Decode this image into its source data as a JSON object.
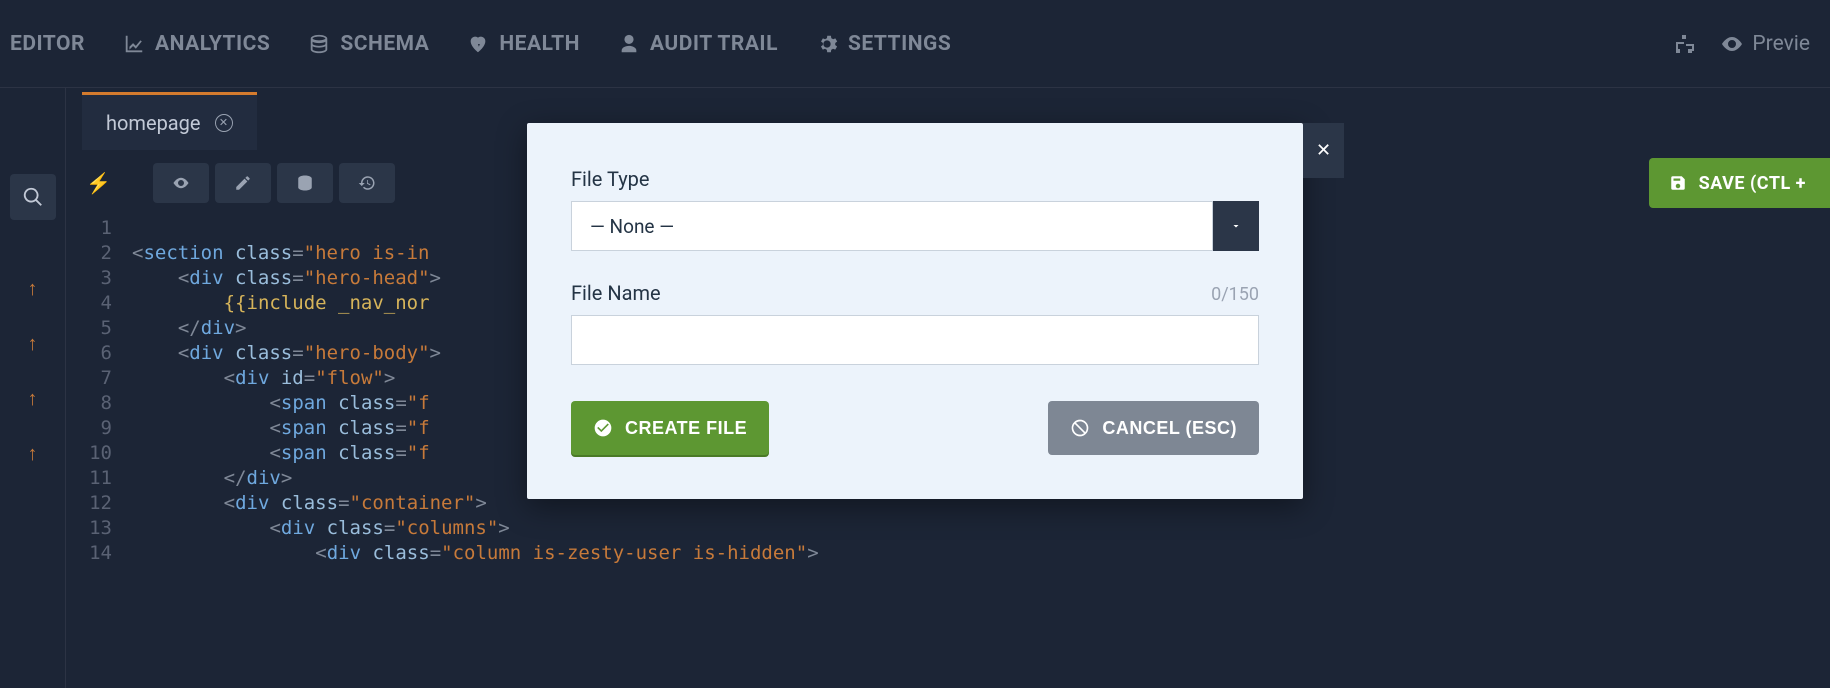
{
  "nav": {
    "items": [
      {
        "label": "EDITOR"
      },
      {
        "label": "ANALYTICS"
      },
      {
        "label": "SCHEMA"
      },
      {
        "label": "HEALTH"
      },
      {
        "label": "AUDIT TRAIL"
      },
      {
        "label": "SETTINGS"
      }
    ],
    "preview_label": "Previe"
  },
  "tab": {
    "label": "homepage"
  },
  "save_button": "SAVE (CTL + ",
  "code": {
    "line_numbers": [
      "1",
      "2",
      "3",
      "4",
      "5",
      "6",
      "7",
      "8",
      "9",
      "10",
      "11",
      "12",
      "13",
      "14"
    ],
    "lines_raw": [
      "",
      "<section class=\"hero is-in",
      "    <div class=\"hero-head\">",
      "        {{include _nav_nor",
      "    </div>",
      "    <div class=\"hero-body\">",
      "        <div id=\"flow\">",
      "            <span class=\"f",
      "            <span class=\"f",
      "            <span class=\"f",
      "        </div>",
      "        <div class=\"container\">",
      "            <div class=\"columns\">",
      "                <div class=\"column is-zesty-user is-hidden\">"
    ]
  },
  "modal": {
    "file_type_label": "File Type",
    "file_type_value": "— None —",
    "file_name_label": "File Name",
    "counter": "0/150",
    "file_name_value": "",
    "create_label": "CREATE FILE",
    "cancel_label": "CANCEL (ESC)"
  }
}
